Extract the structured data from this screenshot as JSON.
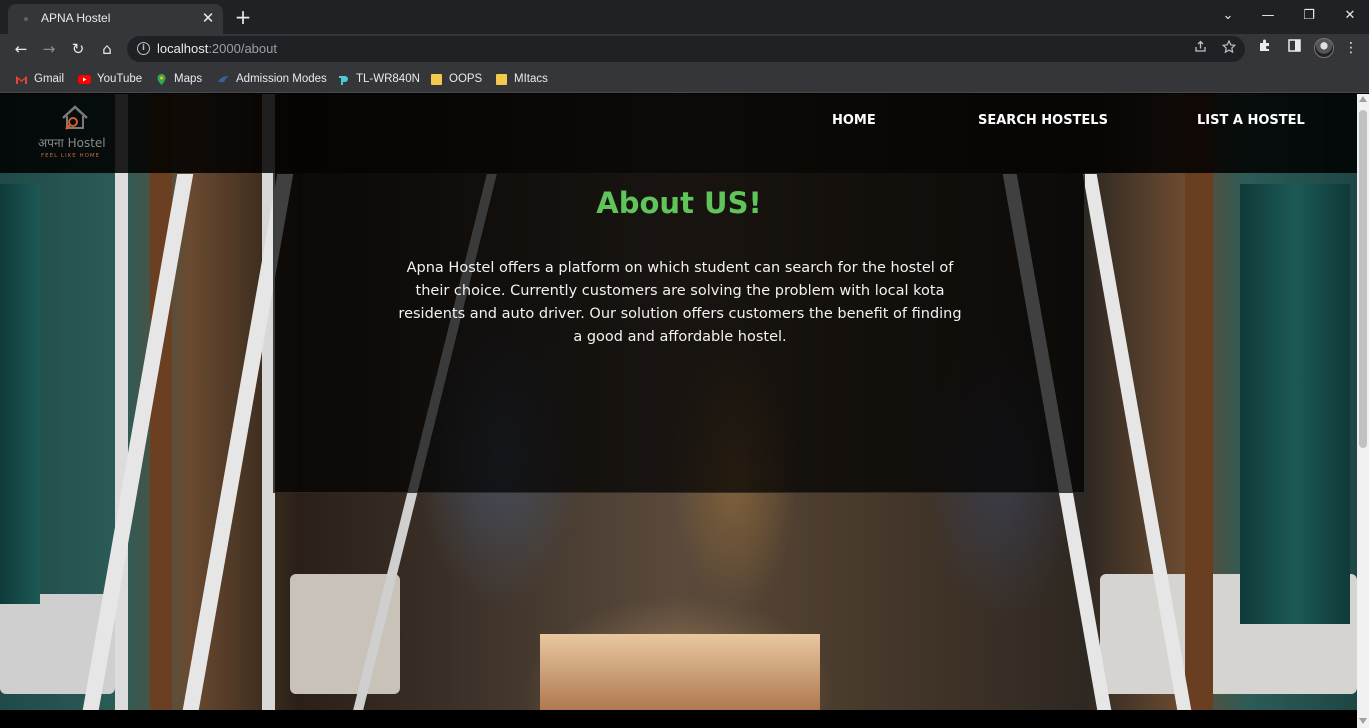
{
  "browser": {
    "tab": {
      "title": "APNA Hostel",
      "close_glyph": "✕"
    },
    "new_tab_glyph": "+",
    "window_controls": {
      "tab_search": "⌄",
      "minimize": "—",
      "restore": "❐",
      "close": "✕"
    },
    "nav": {
      "back": "←",
      "forward": "→",
      "reload": "↻",
      "home": "⌂"
    },
    "omnibox": {
      "host": "localhost",
      "path": ":2000/about"
    },
    "bookmarks": [
      {
        "label": "Gmail",
        "icon": "gmail-icon",
        "color": "#ea4335"
      },
      {
        "label": "YouTube",
        "icon": "youtube-icon",
        "color": "#ff0000"
      },
      {
        "label": "Maps",
        "icon": "maps-icon",
        "color": "#34a853"
      },
      {
        "label": "Admission Modes",
        "icon": "admission-icon",
        "color": "#3b5f9a"
      },
      {
        "label": "TL-WR840N",
        "icon": "tplink-icon",
        "color": "#4acbd6"
      },
      {
        "label": "OOPS",
        "icon": "folder-icon",
        "color": "#f2c94c"
      },
      {
        "label": "MItacs",
        "icon": "folder-icon",
        "color": "#f2c94c"
      }
    ]
  },
  "site": {
    "logo": {
      "brand_hindi": "अपना",
      "brand_en": "Hostel",
      "tagline": "FEEL LIKE HOME"
    },
    "nav": [
      {
        "label": "HOME"
      },
      {
        "label": "SEARCH HOSTELS"
      },
      {
        "label": "LIST A HOSTEL"
      }
    ],
    "about": {
      "title": "About US!",
      "text": "Apna Hostel offers a platform on which student can search for the hostel of their choice. Currently customers are solving the problem with local kota residents and auto driver. Our solution offers customers the benefit of finding a good and affordable hostel."
    },
    "accent_color": "#5fc45a"
  }
}
